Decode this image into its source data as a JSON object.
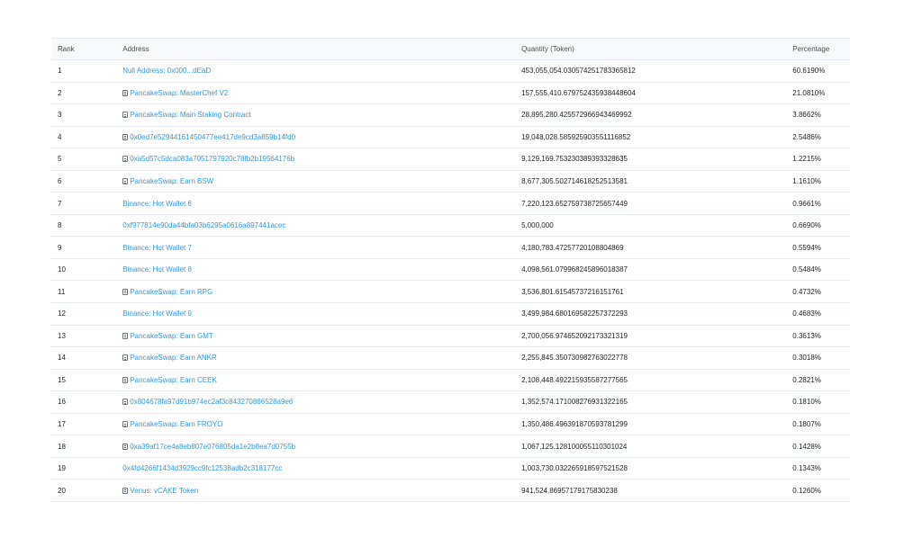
{
  "table": {
    "headers": {
      "rank": "Rank",
      "address": "Address",
      "quantity": "Quantity (Token)",
      "percentage": "Percentage"
    },
    "icons": {
      "contract": "contract-file-icon"
    },
    "rows": [
      {
        "rank": "1",
        "address": "Null Address: 0x000...dEaD",
        "contract": false,
        "quantity": "453,055,054.030574251783365812",
        "percentage": "60.6190%"
      },
      {
        "rank": "2",
        "address": "PancakeSwap: MasterChef V2",
        "contract": true,
        "quantity": "157,555,410.679752435938448604",
        "percentage": "21.0810%"
      },
      {
        "rank": "3",
        "address": "PancakeSwap: Main Staking Contract",
        "contract": true,
        "quantity": "28,895,280.425572966943469992",
        "percentage": "3.8662%"
      },
      {
        "rank": "4",
        "address": "0x0ed7e52944161450477ee417de9cd3a859b14fd0",
        "contract": true,
        "quantity": "19,048,028.585925903551116852",
        "percentage": "2.5486%"
      },
      {
        "rank": "5",
        "address": "0xa5d57c5dca083a7051797920c78fb2b19564176b",
        "contract": true,
        "quantity": "9,129,169.753230389393328635",
        "percentage": "1.2215%"
      },
      {
        "rank": "6",
        "address": "PancakeSwap: Earn BSW",
        "contract": true,
        "quantity": "8,677,305.502714618252513581",
        "percentage": "1.1610%"
      },
      {
        "rank": "7",
        "address": "Binance: Hot Wallet 6",
        "contract": false,
        "quantity": "7,220,123.652759738725657449",
        "percentage": "0.9661%"
      },
      {
        "rank": "8",
        "address": "0xf977814e90da44bfa03b6295a0616a897441acec",
        "contract": false,
        "quantity": "5,000,000",
        "percentage": "0.6690%"
      },
      {
        "rank": "9",
        "address": "Binance: Hot Wallet 7",
        "contract": false,
        "quantity": "4,180,783.47257720108804869",
        "percentage": "0.5594%"
      },
      {
        "rank": "10",
        "address": "Binance: Hot Wallet 8",
        "contract": false,
        "quantity": "4,098,561.079968245896018387",
        "percentage": "0.5484%"
      },
      {
        "rank": "11",
        "address": "PancakeSwap: Earn RPG",
        "contract": true,
        "quantity": "3,536,801.61545737216151761",
        "percentage": "0.4732%"
      },
      {
        "rank": "12",
        "address": "Binance: Hot Wallet 9",
        "contract": false,
        "quantity": "3,499,984.680169582257372293",
        "percentage": "0.4683%"
      },
      {
        "rank": "13",
        "address": "PancakeSwap: Earn GMT",
        "contract": true,
        "quantity": "2,700,056.974652092173321319",
        "percentage": "0.3613%"
      },
      {
        "rank": "14",
        "address": "PancakeSwap: Earn ANKR",
        "contract": true,
        "quantity": "2,255,845.350730982763022778",
        "percentage": "0.3018%"
      },
      {
        "rank": "15",
        "address": "PancakeSwap: Earn CEEK",
        "contract": true,
        "quantity": "2,108,448.492215935587277565",
        "percentage": "0.2821%"
      },
      {
        "rank": "16",
        "address": "0x804678fa97d91b974ec2af3c843270886528a9e6",
        "contract": true,
        "quantity": "1,352,574.171008276931322165",
        "percentage": "0.1810%"
      },
      {
        "rank": "17",
        "address": "PancakeSwap: Earn FROYO",
        "contract": true,
        "quantity": "1,350,486.496391870593781299",
        "percentage": "0.1807%"
      },
      {
        "rank": "18",
        "address": "0xa39af17ce4a8eb807e076805da1e2b8ea7d0755b",
        "contract": true,
        "quantity": "1,067,125.128100055110301024",
        "percentage": "0.1428%"
      },
      {
        "rank": "19",
        "address": "0x4fd4266f1434d3929cc9fc12538adb2c318177cc",
        "contract": false,
        "quantity": "1,003,730.032265918597521528",
        "percentage": "0.1343%"
      },
      {
        "rank": "20",
        "address": "Venus: vCAKE Token",
        "contract": true,
        "quantity": "941,524.86957179175830238",
        "percentage": "0.1260%"
      }
    ]
  }
}
